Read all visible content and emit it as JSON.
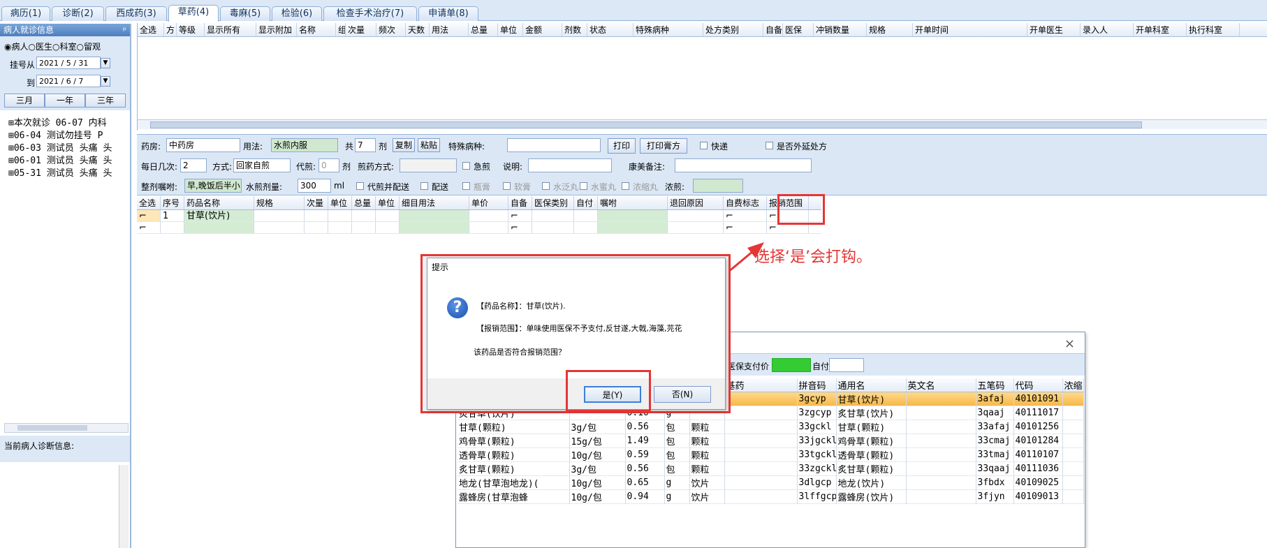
{
  "tabs": [
    "病历(1)",
    "诊断(2)",
    "西成药(3)",
    "草药(4)",
    "毒麻(5)",
    "检验(6)",
    "检查手术治疗(7)",
    "申请单(8)"
  ],
  "left": {
    "title": "病人就诊信息",
    "pin": "ᵖ",
    "radios": [
      "病人",
      "医生",
      "科室",
      "留观"
    ],
    "reg_from_label": "挂号从",
    "reg_from": "2021 / 5 / 31",
    "to_label": "到",
    "to": "2021 / 6 / 7",
    "range_buttons": [
      "三月",
      "一年",
      "三年"
    ],
    "tree": [
      "本次就诊 06-07  内科",
      "06-04 测试勿挂号   P",
      "06-03 测试员 头痛 头",
      "06-01 测试员 头痛 头",
      "05-31 测试员 头痛 头"
    ],
    "diag_title": "当前病人诊断信息:"
  },
  "top_grid": {
    "columns": [
      "全选",
      "方",
      "等级",
      "显示所有",
      "显示附加",
      "名称",
      "组",
      "次量",
      "频次",
      "天数",
      "用法",
      "总量",
      "单位",
      "金额",
      "剂数",
      "状态",
      "特殊病种",
      "处方类别",
      "自备",
      "医保",
      "冲销数量",
      "规格",
      "开单时间",
      "开单医生",
      "录入人",
      "开单科室",
      "执行科室"
    ]
  },
  "form": {
    "pharmacy_label": "药房:",
    "pharmacy": "中药房",
    "usage_label": "用法:",
    "usage": "水煎内服",
    "total_label": "共",
    "doses": "7",
    "dose_unit": "剂",
    "copy": "复制",
    "paste": "粘贴",
    "disease_label": "特殊病种:",
    "print": "打印",
    "print_paste": "打印膏方",
    "express": "快递",
    "extended": "是否外延处方",
    "daily_label": "每日几次:",
    "daily": "2",
    "method_label": "方式:",
    "method": "回家自煎",
    "decoct_label": "代煎:",
    "decoct": "0",
    "decoct_unit": "剂",
    "decoct_method_label": "煎药方式:",
    "urgent": "急煎",
    "note_label": "说明:",
    "kangmei_label": "康美备注:",
    "order_label": "整剂嘱咐:",
    "order": "早,晚饭后半小",
    "water_label": "水煎剂量:",
    "water": "300",
    "water_unit": "ml",
    "delivery_check": "代煎并配送",
    "delivery": "配送",
    "paste_opt": "瓶膏",
    "soft": "软膏",
    "pill1": "水泛丸",
    "pill2": "水蜜丸",
    "pill3": "浓缩丸",
    "conc_label": "浓煎:"
  },
  "herb_grid": {
    "columns": [
      "全选",
      "序号",
      "药品名称",
      "规格",
      "次量",
      "单位",
      "总量",
      "单位",
      "细目用法",
      "单价",
      "自备",
      "医保类别",
      "自付",
      "嘱咐",
      "退回原因",
      "自费标志",
      "报销范围"
    ],
    "rows": [
      {
        "no": "1",
        "name": "甘草(饮片)"
      },
      {
        "no": "",
        "name": ""
      }
    ]
  },
  "annotation": "选择‘是’会打钩。",
  "dialog": {
    "title": "提示",
    "line1": "【药品名称】：甘草(饮片).",
    "line2": "【报销范围】：单味使用医保不予支付,反甘遂,大戟,海藻,芫花",
    "line3": "该药品是否符合报销范围？",
    "yes": "是(Y)",
    "no": "否(N)",
    "icon": "question-icon"
  },
  "picker": {
    "close": "×",
    "insurance_label": "医保支付价",
    "self_label": "自付",
    "columns": [
      "",
      "",
      "",
      "",
      "",
      "基药",
      "拼音码",
      "通用名",
      "英文名",
      "五笔码",
      "代码",
      "浓缩"
    ],
    "rows": [
      [
        "",
        "",
        "",
        "",
        "",
        "",
        "3gcyp",
        "甘草(饮片)",
        "",
        "3afaj",
        "40101091"
      ],
      [
        "炙甘草(饮片)",
        "",
        "0.10",
        "g",
        "",
        "",
        "3zgcyp",
        "炙甘草(饮片)",
        "",
        "3qaaj",
        "40111017"
      ],
      [
        "甘草(颗粒)",
        "3g/包",
        "0.56",
        "包",
        "颗粒",
        "",
        "33gckl",
        "甘草(颗粒)",
        "",
        "33afaj",
        "40101256"
      ],
      [
        "鸡骨草(颗粒)",
        "15g/包",
        "1.49",
        "包",
        "颗粒",
        "",
        "33jgckl",
        "鸡骨草(颗粒)",
        "",
        "33cmaj",
        "40101284"
      ],
      [
        "透骨草(颗粒)",
        "10g/包",
        "0.59",
        "包",
        "颗粒",
        "",
        "33tgckl",
        "透骨草(颗粒)",
        "",
        "33tmaj",
        "40110107"
      ],
      [
        "炙甘草(颗粒)",
        "3g/包",
        "0.56",
        "包",
        "颗粒",
        "",
        "33zgckl",
        "炙甘草(颗粒)",
        "",
        "33qaaj",
        "40111036"
      ],
      [
        "地龙(甘草泡地龙)(",
        "10g/包",
        "0.65",
        "g",
        "饮片",
        "",
        "3dlgcp",
        "地龙(饮片)",
        "",
        "3fbdx",
        "40109025"
      ],
      [
        "露蜂房(甘草泡蜂",
        "10g/包",
        "0.94",
        "g",
        "饮片",
        "",
        "3lffgcp",
        "露蜂房(饮片)",
        "",
        "3fjyn",
        "40109013"
      ]
    ]
  }
}
